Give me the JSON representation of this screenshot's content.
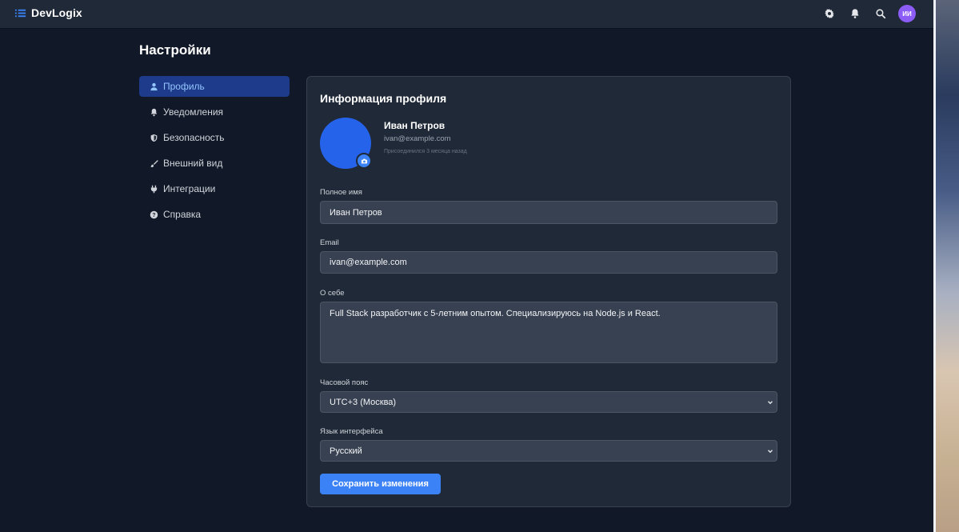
{
  "app": {
    "brand_name": "DevLogix",
    "icons": [
      "menu-list-icon",
      "gear-icon",
      "bell-icon",
      "search-icon"
    ],
    "avatar_initials": "ИИ"
  },
  "page": {
    "title": "Настройки"
  },
  "sidebar": {
    "items": [
      {
        "label": "Профиль",
        "icon": "user-icon",
        "active": true
      },
      {
        "label": "Уведомления",
        "icon": "bell-icon",
        "active": false
      },
      {
        "label": "Безопасность",
        "icon": "shield-icon",
        "active": false
      },
      {
        "label": "Внешний вид",
        "icon": "brush-icon",
        "active": false
      },
      {
        "label": "Интеграции",
        "icon": "plug-icon",
        "active": false
      },
      {
        "label": "Справка",
        "icon": "question-icon",
        "active": false
      }
    ]
  },
  "profile": {
    "card_title": "Информация профиля",
    "name": "Иван Петров",
    "email": "ivan@example.com",
    "joined": "Присоединился 3 месяца назад"
  },
  "form": {
    "full_name_label": "Полное имя",
    "full_name_value": "Иван Петров",
    "email_label": "Email",
    "email_value": "ivan@example.com",
    "bio_label": "О себе",
    "bio_value": "Full Stack разработчик с 5-летним опытом. Специализируюсь на Node.js и React.",
    "timezone_label": "Часовой пояс",
    "timezone_value": "UTC+3 (Москва)",
    "language_label": "Язык интерфейса",
    "language_value": "Русский",
    "save_label": "Сохранить изменения"
  },
  "colors": {
    "background": "#111827",
    "panel": "#1f2937",
    "accent": "#3b82f6",
    "active_nav": "#1e3a8a",
    "avatar": "#2563eb"
  }
}
